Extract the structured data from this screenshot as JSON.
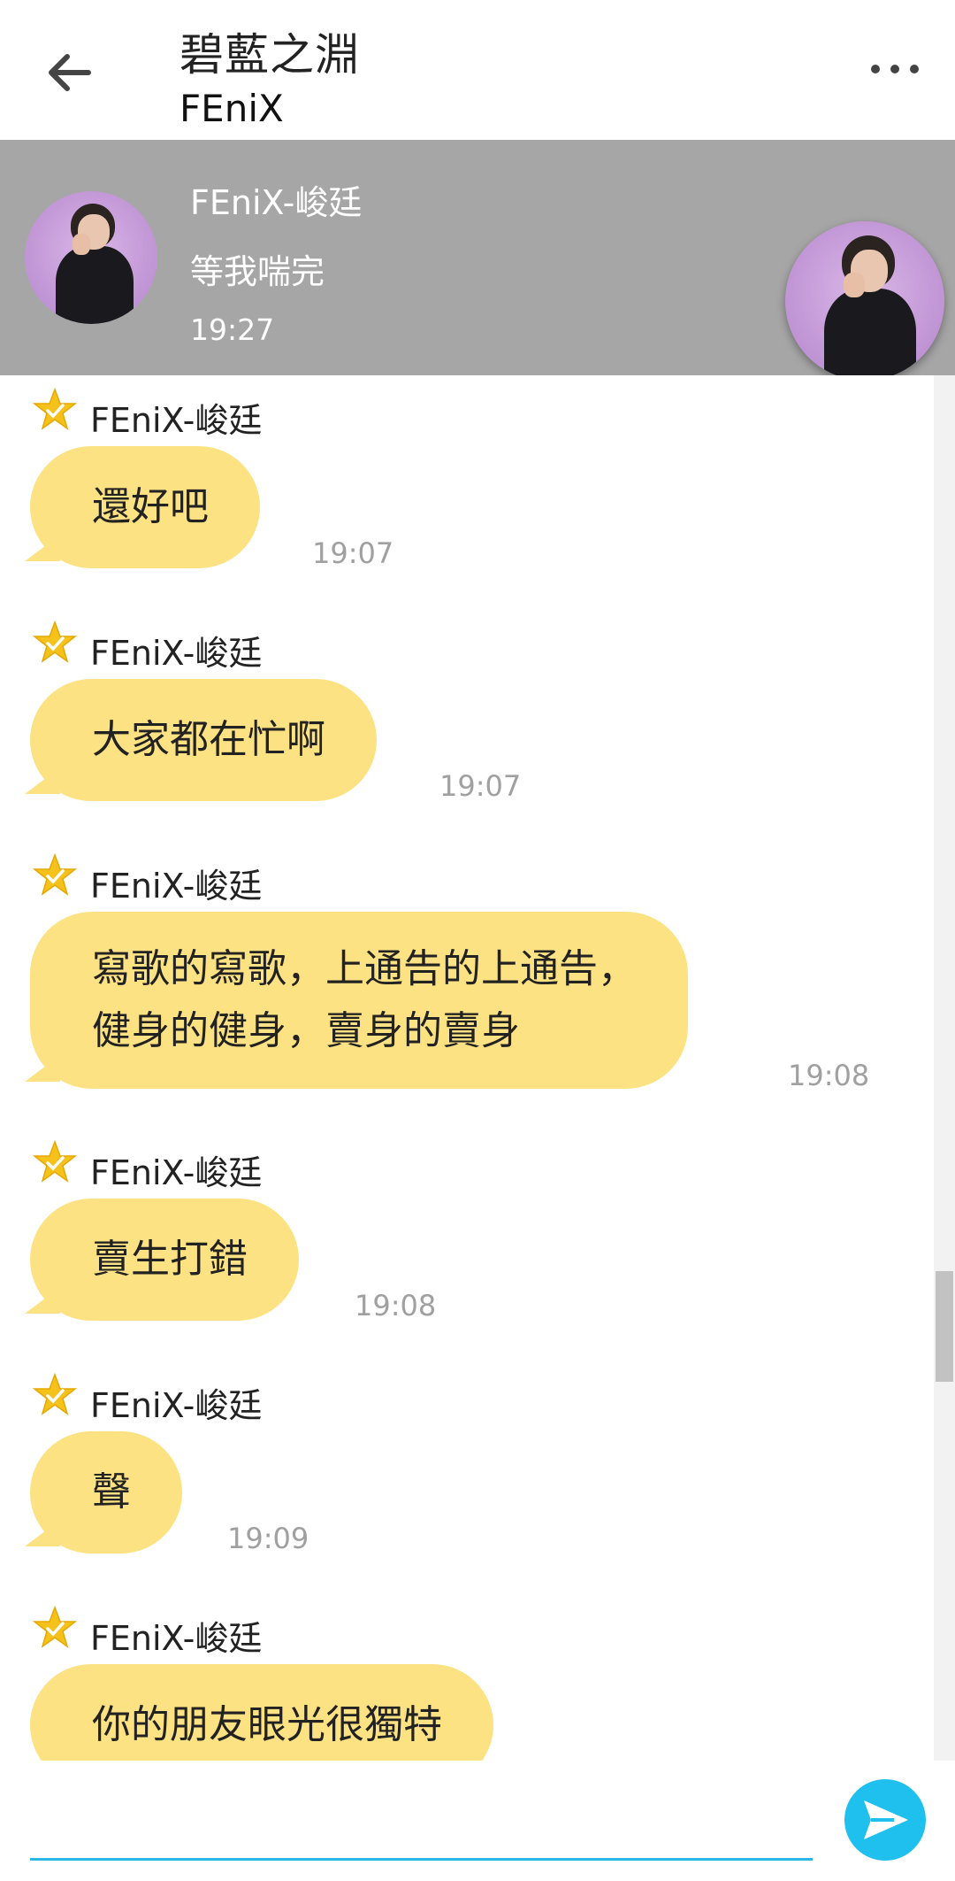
{
  "header": {
    "title": "碧藍之淵",
    "subtitle": "FEniX"
  },
  "pinned": {
    "name": "FEniX-峻廷",
    "message": "等我喘完",
    "time": "19:27"
  },
  "messages": [
    {
      "sender": "FEniX-峻廷",
      "text": "還好吧",
      "time": "19:07"
    },
    {
      "sender": "FEniX-峻廷",
      "text": "大家都在忙啊",
      "time": "19:07"
    },
    {
      "sender": "FEniX-峻廷",
      "text": "寫歌的寫歌，上通告的上通告，\n健身的健身，賣身的賣身",
      "time": "19:08"
    },
    {
      "sender": "FEniX-峻廷",
      "text": "賣生打錯",
      "time": "19:08"
    },
    {
      "sender": "FEniX-峻廷",
      "text": "聲",
      "time": "19:09"
    },
    {
      "sender": "FEniX-峻廷",
      "text": "你的朋友眼光很獨特",
      "time": ""
    }
  ],
  "input": {
    "placeholder": "",
    "value": ""
  },
  "colors": {
    "bubble": "#fde283",
    "banner": "#a6a6a6",
    "accent": "#1fc0ee",
    "star": "#f5c21b"
  },
  "icons": {
    "back": "arrow-left-icon",
    "more": "more-horizontal-icon",
    "star": "star-check-icon",
    "send": "send-icon"
  }
}
